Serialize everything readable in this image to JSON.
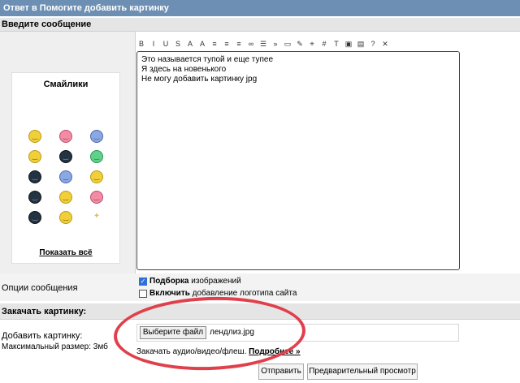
{
  "window": {
    "title": "Ответ в Помогите добавить картинку"
  },
  "section_message": {
    "title": "Введите сообщение"
  },
  "smileys": {
    "title": "Смайлики",
    "show_all": "Показать всё",
    "icons": [
      "smile-icon",
      "kiss-icon",
      "cool-icon",
      "thinking-icon",
      "gun-icon",
      "cat-icon",
      "spear-icon",
      "wizard-icon",
      "dancer-icon",
      "spider-icon",
      "gift-icon",
      "wings-icon",
      "crab-icon",
      "laugh-icon",
      "sparkle-icon"
    ]
  },
  "toolbar": {
    "buttons": [
      {
        "label": "B",
        "name": "bold-button"
      },
      {
        "label": "I",
        "name": "italic-button"
      },
      {
        "label": "U",
        "name": "underline-button"
      },
      {
        "label": "S",
        "name": "strike-button"
      },
      {
        "label": "A",
        "name": "font-color-button"
      },
      {
        "label": "A",
        "name": "font-size-button"
      },
      {
        "label": "≡",
        "name": "align-left-button"
      },
      {
        "label": "≡",
        "name": "align-center-button"
      },
      {
        "label": "≡",
        "name": "align-right-button"
      },
      {
        "label": "∞",
        "name": "link-button"
      },
      {
        "label": "☰",
        "name": "list-button"
      },
      {
        "label": "»",
        "name": "quote-button"
      },
      {
        "label": "▭",
        "name": "code-button"
      },
      {
        "label": "✎",
        "name": "edit-button"
      },
      {
        "label": "⌖",
        "name": "spoiler-button"
      },
      {
        "label": "#",
        "name": "hash-button"
      },
      {
        "label": "T",
        "name": "text-button"
      },
      {
        "label": "▣",
        "name": "image-button"
      },
      {
        "label": "▤",
        "name": "video-button"
      },
      {
        "label": "?",
        "name": "help-button"
      },
      {
        "label": "✕",
        "name": "clear-button"
      }
    ]
  },
  "editor": {
    "lines": [
      "Это называется тупой и еще тупее",
      "Я здесь на новенького",
      "Не могу добавить картинку jpg"
    ]
  },
  "options": {
    "label": "Опции сообщения",
    "opt1_bold": "Подборка",
    "opt1_rest": " изображений",
    "opt2_bold": "Включить",
    "opt2_rest": " добавление логотипа сайта",
    "opt1_checked": true,
    "opt2_checked": false
  },
  "upload_section": {
    "title": "Закачать картинку:"
  },
  "upload": {
    "label": "Добавить картинку:",
    "max_size": "Максимальный размер: 3мб",
    "choose_button": "Выберите файл",
    "file_name": "лендлиз.jpg",
    "audio_text": "Закачать аудио/видео/флеш.",
    "more_link": "Подробнее »"
  },
  "actions": {
    "submit": "Отправить",
    "preview": "Предварительный просмотр"
  },
  "colors": {
    "titlebar": "#6d8fb4",
    "annotation": "#e0404b"
  }
}
